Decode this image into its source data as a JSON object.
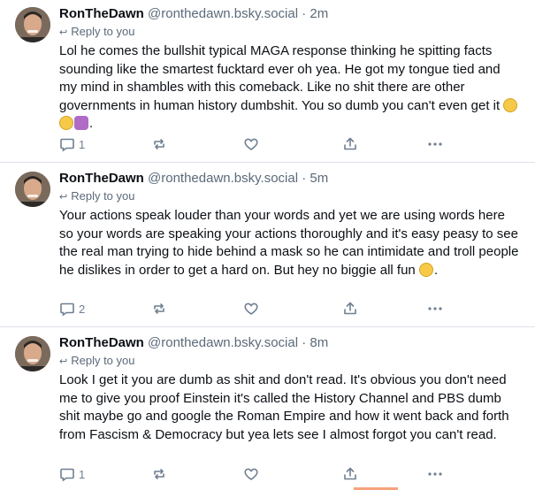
{
  "posts": [
    {
      "author": "RonTheDawn",
      "handle": "@ronthedawn.bsky.social",
      "separator": "·",
      "time": "2m",
      "reply_label": "Reply to you",
      "text": "Lol he comes the bullshit typical MAGA response thinking he spitting facts sounding like the smartest fucktard ever oh yea. He got my tongue tied and my mind in shambles with this comeback. Like no shit there are other governments in human history dumbshit. You so dumb you can't even get it ",
      "text_tail": ".",
      "emojis": [
        "eye-roll-emoji",
        "laughing-emoji",
        "facepalm-emoji"
      ],
      "reply_count": "1",
      "repost_count": "",
      "like_count": ""
    },
    {
      "author": "RonTheDawn",
      "handle": "@ronthedawn.bsky.social",
      "separator": "·",
      "time": "5m",
      "reply_label": "Reply to you",
      "text": "Your actions speak louder than your words and yet we are using words here so your words are speaking your actions thoroughly and it's easy peasy to see the real man trying to hide behind a mask so he can intimidate and troll people he dislikes in order to get a hard on. But hey no biggie all fun ",
      "text_tail": ".",
      "emojis": [
        "smiling-emoji"
      ],
      "reply_count": "2",
      "repost_count": "",
      "like_count": ""
    },
    {
      "author": "RonTheDawn",
      "handle": "@ronthedawn.bsky.social",
      "separator": "·",
      "time": "8m",
      "reply_label": "Reply to you",
      "text": "Look I get it you are dumb as shit and don't read. It's obvious you don't need me to give you proof Einstein it's called the History Channel and PBS dumb shit maybe go and google the Roman Empire and how it went back and forth from Fascism & Democracy but yea lets see I almost forgot you can't read.",
      "text_tail": "",
      "emojis": [],
      "reply_count": "1",
      "repost_count": "",
      "like_count": ""
    }
  ],
  "colors": {
    "text": "#0b0f14",
    "muted": "#5b6a7a",
    "divider": "#dde3ea",
    "icon": "#6f7f91"
  }
}
